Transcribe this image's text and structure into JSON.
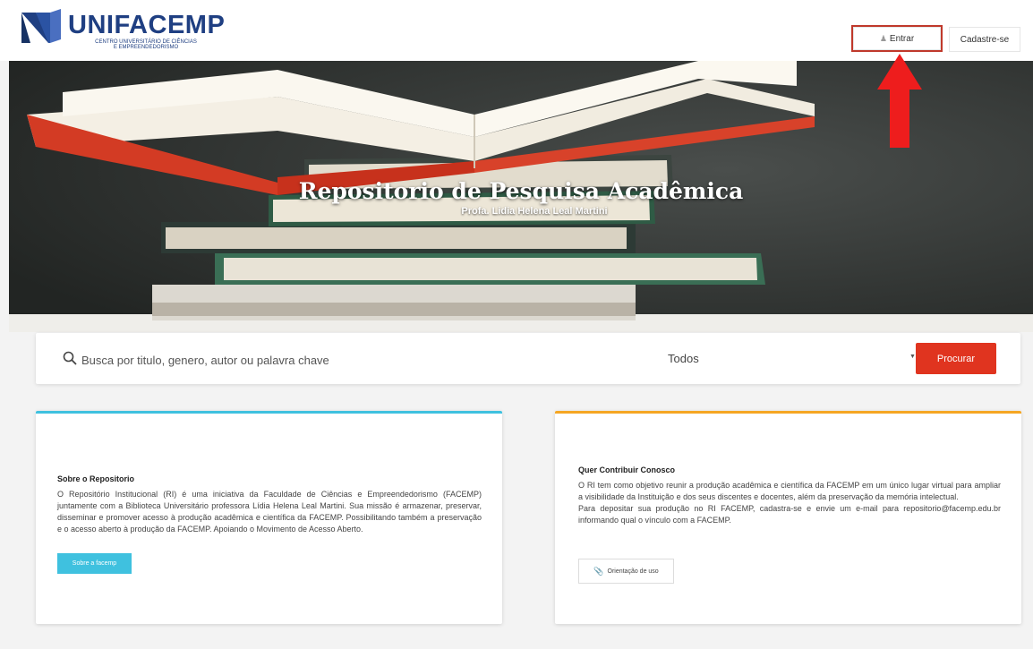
{
  "header": {
    "logo_name": "UNIFACEMP",
    "logo_tagline_line1": "CENTRO UNIVERSITÁRIO DE CIÊNCIAS",
    "logo_tagline_line2": "E EMPREENDEDORISMO",
    "login_label": "Entrar",
    "signup_label": "Cadastre-se"
  },
  "hero": {
    "title": "Repositorio de Pesquisa Acadêmica",
    "subtitle": "Profa. Lidia Helena Leal Martini"
  },
  "search": {
    "placeholder": "Busca por titulo, genero, autor ou palavra chave",
    "filter_value": "Todos",
    "submit_label": "Procurar"
  },
  "about": {
    "heading": "Sobre o Repositorio",
    "body": "O Repositório Institucional (RI) é uma iniciativa da Faculdade de Ciências e Empreendedorismo (FACEMP) juntamente com a Biblioteca Universitário professora Lídia Helena Leal Martini. Sua missão é armazenar, preservar, disseminar e promover acesso à produção acadêmica e científica da FACEMP. Possibilitando também a preservação e o acesso aberto à produção da FACEMP. Apoiando o Movimento de Acesso Aberto.",
    "button_label": "Sobre a facemp"
  },
  "contribute": {
    "heading": "Quer Contribuir Conosco",
    "body_1": "O RI tem como objetivo reunir a produção acadêmica e científica da FACEMP em um único lugar virtual para ampliar a visibilidade da Instituição e dos seus discentes e docentes, além da preservação da memória intelectual.",
    "body_2": "Para depositar sua produção no RI FACEMP, cadastra-se e envie um e-mail para repositorio@facemp.edu.br informando qual o vínculo com a FACEMP.",
    "button_label": "Orientação de uso"
  },
  "colors": {
    "brand_blue": "#1f3f82",
    "accent_red": "#e0341f",
    "accent_cyan": "#3fc1df",
    "accent_orange": "#f5a623",
    "highlight_red": "#c0392b"
  },
  "icons": {
    "logo": "book-logo-icon",
    "user": "user-icon",
    "search": "search-icon",
    "dropdown": "chevron-down-icon",
    "attachment": "paperclip-icon",
    "annotation": "red-arrow-icon"
  }
}
